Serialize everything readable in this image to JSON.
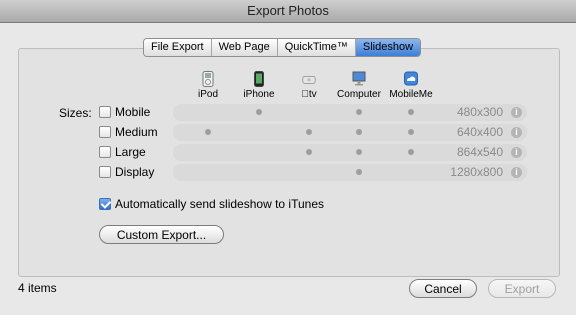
{
  "window": {
    "title": "Export Photos"
  },
  "tabs": [
    {
      "label": "File Export",
      "active": false
    },
    {
      "label": "Web Page",
      "active": false
    },
    {
      "label": "QuickTime™",
      "active": false
    },
    {
      "label": "Slideshow",
      "active": true
    }
  ],
  "devices": [
    {
      "label": "iPod",
      "icon": "ipod-icon"
    },
    {
      "label": "iPhone",
      "icon": "iphone-icon"
    },
    {
      "label": "tv",
      "icon": "apple-tv-icon"
    },
    {
      "label": "Computer",
      "icon": "computer-icon"
    },
    {
      "label": "MobileMe",
      "icon": "mobileme-icon"
    }
  ],
  "sizes": {
    "label": "Sizes:",
    "rows": [
      {
        "label": "Mobile",
        "checked": false,
        "resolution": "480x300",
        "compat": [
          false,
          true,
          false,
          true,
          true
        ]
      },
      {
        "label": "Medium",
        "checked": false,
        "resolution": "640x400",
        "compat": [
          true,
          false,
          true,
          true,
          true
        ]
      },
      {
        "label": "Large",
        "checked": false,
        "resolution": "864x540",
        "compat": [
          false,
          false,
          true,
          true,
          true
        ]
      },
      {
        "label": "Display",
        "checked": false,
        "resolution": "1280x800",
        "compat": [
          false,
          false,
          false,
          true,
          false
        ]
      }
    ]
  },
  "auto_send": {
    "label": "Automatically send slideshow to iTunes",
    "checked": true
  },
  "custom_export_label": "Custom Export...",
  "footer": {
    "items": "4 items",
    "cancel": "Cancel",
    "export": "Export"
  },
  "colors": {
    "active_tab": "#3b7fd8",
    "row_bar": "#dadada",
    "dot": "#9e9e9e"
  }
}
